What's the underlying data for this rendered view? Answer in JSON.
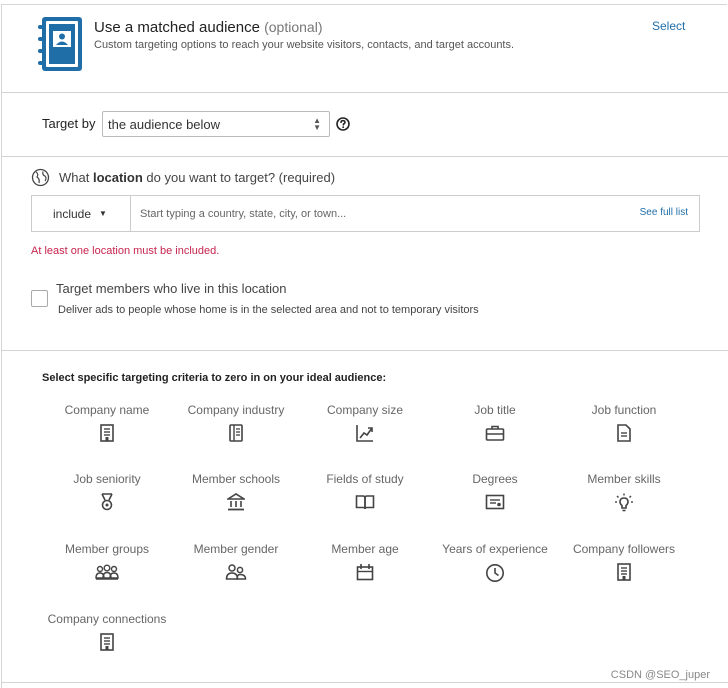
{
  "audience": {
    "title": "Use a matched audience",
    "optional": "(optional)",
    "description": "Custom targeting options to reach your website visitors, contacts, and target accounts.",
    "select_label": "Select",
    "icon": "address-book-icon",
    "icon_color": "#1f6ea8"
  },
  "target_by": {
    "label": "Target by",
    "selected": "the audience below"
  },
  "location": {
    "question_prefix": "What ",
    "question_bold": "location",
    "question_suffix": " do you want to target? (required)",
    "include_label": "include",
    "placeholder": "Start typing a country, state, city, or town...",
    "see_full_list": "See full list",
    "error": "At least one location must be included.",
    "error_color": "#c7254e"
  },
  "members_live": {
    "label": "Target members who live in this location",
    "description": "Deliver ads to people whose home is in the selected area and not to temporary visitors",
    "checked": false
  },
  "criteria": {
    "heading": "Select specific targeting criteria to zero in on your ideal audience:",
    "items": [
      {
        "label": "Company name",
        "icon": "building-icon"
      },
      {
        "label": "Company industry",
        "icon": "company-industry-icon"
      },
      {
        "label": "Company size",
        "icon": "chart-growth-icon"
      },
      {
        "label": "Job title",
        "icon": "briefcase-icon"
      },
      {
        "label": "Job function",
        "icon": "document-icon"
      },
      {
        "label": "Job seniority",
        "icon": "medal-icon"
      },
      {
        "label": "Member schools",
        "icon": "school-icon"
      },
      {
        "label": "Fields of study",
        "icon": "book-icon"
      },
      {
        "label": "Degrees",
        "icon": "certificate-icon"
      },
      {
        "label": "Member skills",
        "icon": "lightbulb-icon"
      },
      {
        "label": "Member groups",
        "icon": "group-icon"
      },
      {
        "label": "Member gender",
        "icon": "people-icon"
      },
      {
        "label": "Member age",
        "icon": "calendar-icon"
      },
      {
        "label": "Years of experience",
        "icon": "clock-icon"
      },
      {
        "label": "Company followers",
        "icon": "building-followers-icon"
      },
      {
        "label": "Company connections",
        "icon": "building-connections-icon"
      }
    ]
  },
  "watermark": "CSDN @SEO_juper"
}
